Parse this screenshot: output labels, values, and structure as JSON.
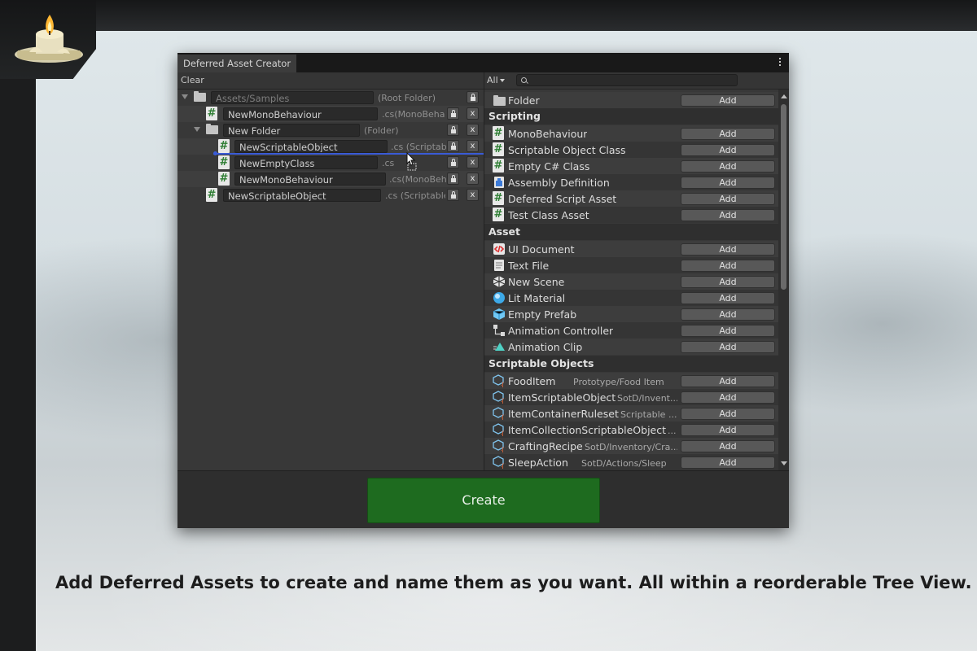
{
  "window": {
    "tab_title": "Deferred Asset Creator"
  },
  "left_toolbar": {
    "clear_label": "Clear"
  },
  "tree": [
    {
      "name": "Assets/Samples",
      "suffix": "(Root Folder)",
      "icon": "folder-icon"
    },
    {
      "name": "NewMonoBehaviour",
      "suffix": ".cs(MonoBehaviour)",
      "icon": "script-icon"
    },
    {
      "name": "New Folder",
      "suffix": "(Folder)",
      "icon": "folder-icon"
    },
    {
      "name": "NewScriptableObject",
      "suffix": ".cs (ScriptableObject)",
      "icon": "script-icon"
    },
    {
      "name": "NewEmptyClass",
      "suffix": ".cs",
      "icon": "script-icon"
    },
    {
      "name": "NewMonoBehaviour",
      "suffix": ".cs(MonoBehaviour)",
      "icon": "script-icon"
    },
    {
      "name": "NewScriptableObject",
      "suffix": ".cs (ScriptableObject)",
      "icon": "script-icon"
    }
  ],
  "right_toolbar": {
    "filter_label": "All",
    "search_placeholder": ""
  },
  "add_label": "Add",
  "assets": {
    "folder": {
      "label": "Folder",
      "icon": "folder-icon"
    },
    "scripting_header": "Scripting",
    "scripting": [
      {
        "label": "MonoBehaviour",
        "icon": "script-icon"
      },
      {
        "label": "Scriptable Object Class",
        "icon": "script-icon"
      },
      {
        "label": "Empty C# Class",
        "icon": "script-icon"
      },
      {
        "label": "Assembly Definition",
        "icon": "assembly-icon"
      },
      {
        "label": "Deferred Script Asset",
        "icon": "script-icon"
      },
      {
        "label": "Test Class Asset",
        "icon": "script-icon"
      }
    ],
    "asset_header": "Asset",
    "asset": [
      {
        "label": "UI Document",
        "icon": "ui-document-icon"
      },
      {
        "label": "Text File",
        "icon": "text-file-icon"
      },
      {
        "label": "New Scene",
        "icon": "scene-icon"
      },
      {
        "label": "Lit Material",
        "icon": "material-icon"
      },
      {
        "label": "Empty Prefab",
        "icon": "prefab-icon"
      },
      {
        "label": "Animation Controller",
        "icon": "animator-icon"
      },
      {
        "label": "Animation Clip",
        "icon": "animation-clip-icon"
      }
    ],
    "so_header": "Scriptable Objects",
    "scriptable_objects": [
      {
        "label": "FoodItem",
        "sub": "Prototype/Food Item",
        "icon": "scriptable-object-icon"
      },
      {
        "label": "ItemScriptableObject",
        "sub": "SotD/Invent...",
        "icon": "scriptable-object-icon"
      },
      {
        "label": "ItemContainerRuleset",
        "sub": "Scriptable ...",
        "icon": "scriptable-object-icon"
      },
      {
        "label": "ItemCollectionScriptableObject",
        "sub": "...",
        "icon": "scriptable-object-icon"
      },
      {
        "label": "CraftingRecipe",
        "sub": "SotD/Inventory/Cra...",
        "icon": "scriptable-object-icon"
      },
      {
        "label": "SleepAction",
        "sub": "SotD/Actions/Sleep",
        "icon": "scriptable-object-icon"
      }
    ]
  },
  "create_label": "Create",
  "caption": "Add Deferred Assets to create and name them as you want. All within a reorderable Tree View.",
  "colors": {
    "create": "#1e6b1f",
    "drop_indicator": "#3a5bd6",
    "csharp": "#2d7d32"
  }
}
